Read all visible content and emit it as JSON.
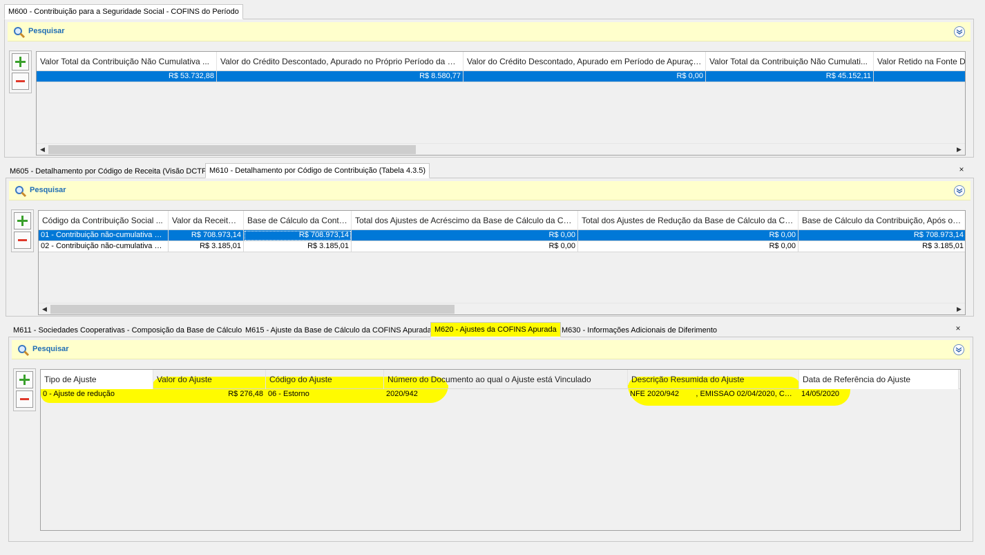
{
  "panel1": {
    "tabs": [
      {
        "label": "M600 - Contribuição para a Seguridade Social - COFINS do Período",
        "active": true
      }
    ],
    "search_label": "Pesquisar",
    "columns": [
      "Valor Total da Contribuição Não Cumulativa ...",
      "Valor do Crédito Descontado, Apurado no Próprio Período da Es...",
      "Valor do Crédito Descontado, Apurado em Período de Apuraçã...",
      "Valor Total da Contribuição Não Cumulati...",
      "Valor Retido na Fonte De"
    ],
    "rows": [
      [
        "R$ 53.732,88",
        "R$ 8.580,77",
        "R$ 0,00",
        "R$ 45.152,11",
        ""
      ]
    ]
  },
  "panel2": {
    "tabs": [
      {
        "label": "M605 - Detalhamento por Código de Receita (Visão DCTF)",
        "active": false
      },
      {
        "label": "M610 - Detalhamento por Código de Contribuição (Tabela 4.3.5)",
        "active": true
      }
    ],
    "close_label": "×",
    "search_label": "Pesquisar",
    "columns": [
      "Código da Contribuição Social ...",
      "Valor da Receita ...",
      "Base de Cálculo da Contri...",
      "Total dos Ajustes de Acréscimo da Base de Cálculo da Con...",
      "Total dos Ajustes de Redução da Base de Cálculo da Con...",
      "Base de Cálculo da Contribuição, Após os ..."
    ],
    "rows": [
      [
        "01 - Contribuição não-cumulativa ap...",
        "R$ 708.973,14",
        "R$ 708.973,14",
        "R$ 0,00",
        "R$ 0,00",
        "R$ 708.973,14"
      ],
      [
        "02 - Contribuição não-cumulativa ap...",
        "R$ 3.185,01",
        "R$ 3.185,01",
        "R$ 0,00",
        "R$ 0,00",
        "R$ 3.185,01"
      ]
    ]
  },
  "panel3": {
    "tabs": [
      {
        "label": "M611 - Sociedades Cooperativas - Composição da Base de Cálculo",
        "active": false
      },
      {
        "label": "M615 - Ajuste da Base de Cálculo da COFINS Apurada",
        "active": false
      },
      {
        "label": "M620 - Ajustes da COFINS Apurada",
        "active": true
      },
      {
        "label": "M630 - Informações Adicionais de Diferimento",
        "active": false
      }
    ],
    "close_label": "×",
    "search_label": "Pesquisar",
    "columns": [
      "Tipo de Ajuste",
      "Valor do Ajuste",
      "Código do Ajuste",
      "Número do Documento ao qual o Ajuste está Vinculado",
      "Descrição Resumida do Ajuste",
      "Data de Referência do Ajuste"
    ],
    "rows": [
      [
        "0 - Ajuste de redução",
        "R$ 276,48",
        "06 - Estorno",
        "2020/942",
        "NFE 2020/942        , EMISSAO 02/04/2020, CANC...",
        "14/05/2020"
      ]
    ]
  },
  "colors": {
    "selection": "#0078d7",
    "highlight": "#fffb00",
    "search_bar": "#ffffcc",
    "search_text": "#1f6db5"
  },
  "icons": [
    "search-icon",
    "collapse-icon",
    "add-icon",
    "remove-icon",
    "arrow-left-icon",
    "arrow-right-icon",
    "close-icon"
  ]
}
